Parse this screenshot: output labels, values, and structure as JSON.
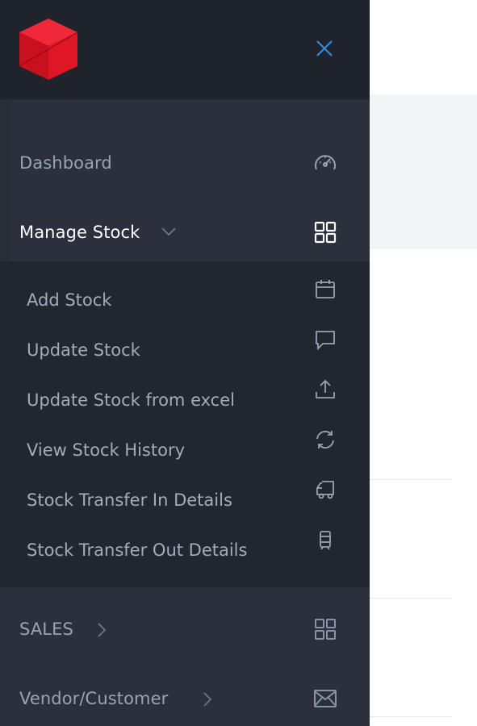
{
  "app": {
    "logo_icon": "red-cube-logo-icon"
  },
  "colors": {
    "sidebar_bg": "#2b303c",
    "brand_bg": "#1f232c",
    "submenu_bg": "#22262f",
    "close_accent": "#2f8fdc",
    "logo_red": "#e8192c",
    "text_muted": "#9aa3b4",
    "text_active": "#ffffff"
  },
  "header": {
    "close_icon": "close-icon"
  },
  "nav": {
    "dashboard": {
      "label": "Dashboard",
      "icon": "speedometer-icon"
    },
    "manage_stock": {
      "label": "Manage Stock",
      "icon": "grid-icon",
      "expanded": true
    },
    "sales": {
      "label": "SALES",
      "icon": "grid-icon"
    },
    "vendor": {
      "label": "Vendor/Customer",
      "icon": "envelope-icon"
    }
  },
  "submenu": {
    "items": [
      {
        "label": "Add Stock",
        "icon": "calendar-icon"
      },
      {
        "label": "Update Stock",
        "icon": "chat-bubble-icon"
      },
      {
        "label": "Update Stock from excel",
        "icon": "upload-icon"
      },
      {
        "label": "View Stock History",
        "icon": "refresh-icon"
      },
      {
        "label": "Stock Transfer In Details",
        "icon": "truck-icon"
      },
      {
        "label": "Stock Transfer Out Details",
        "icon": "tram-icon"
      }
    ]
  }
}
